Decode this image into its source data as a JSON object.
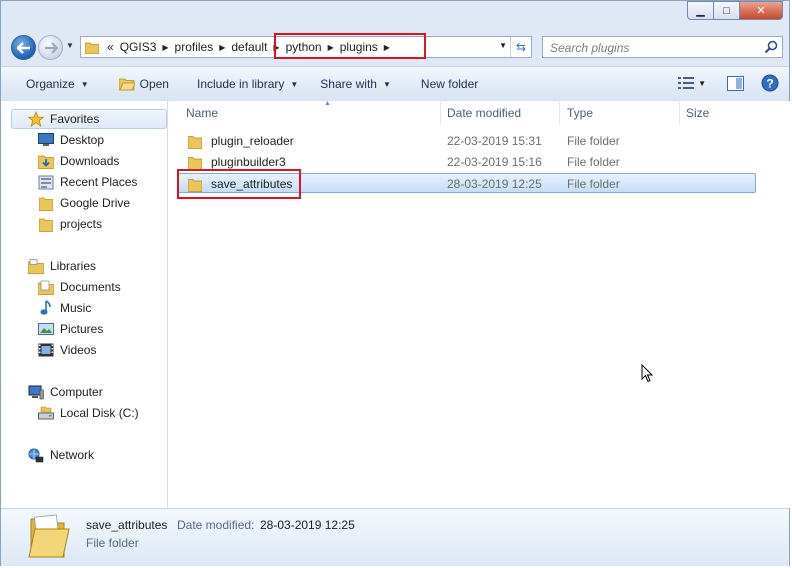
{
  "window": {
    "controls": {
      "minimize": "▁",
      "maximize": "□",
      "close": "✕"
    }
  },
  "nav": {
    "breadcrumb_prefix": "«",
    "breadcrumb": [
      "QGIS3",
      "profiles",
      "default",
      "python",
      "plugins"
    ],
    "search_placeholder": "Search plugins",
    "highlight_color": "#d8161e"
  },
  "toolbar": {
    "organize": "Organize",
    "open": "Open",
    "include_in_library": "Include in library",
    "share_with": "Share with",
    "new_folder": "New folder"
  },
  "sidebar": {
    "favorites": {
      "label": "Favorites",
      "items": [
        "Desktop",
        "Downloads",
        "Recent Places",
        "Google Drive",
        "projects"
      ]
    },
    "libraries": {
      "label": "Libraries",
      "items": [
        "Documents",
        "Music",
        "Pictures",
        "Videos"
      ]
    },
    "computer": {
      "label": "Computer",
      "items": [
        "Local Disk (C:)"
      ]
    },
    "network": {
      "label": "Network"
    }
  },
  "columns": {
    "name": "Name",
    "date_modified": "Date modified",
    "type": "Type",
    "size": "Size"
  },
  "files": [
    {
      "name": "plugin_reloader",
      "date": "22-03-2019 15:31",
      "type": "File folder",
      "selected": false
    },
    {
      "name": "pluginbuilder3",
      "date": "22-03-2019 15:16",
      "type": "File folder",
      "selected": false
    },
    {
      "name": "save_attributes",
      "date": "28-03-2019 12:25",
      "type": "File folder",
      "selected": true
    }
  ],
  "details": {
    "name": "save_attributes",
    "date_label": "Date modified:",
    "date_value": "28-03-2019 12:25",
    "type": "File folder"
  }
}
